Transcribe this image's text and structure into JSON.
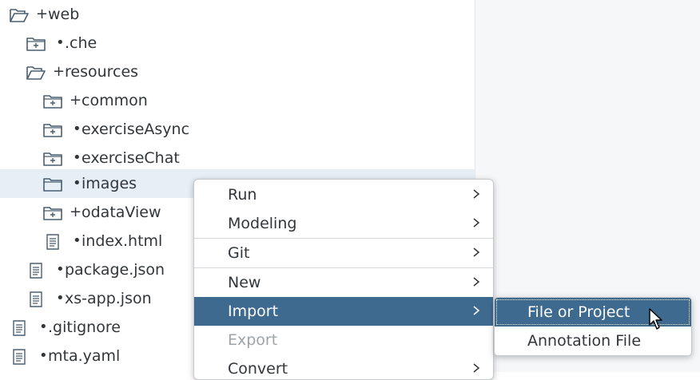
{
  "tree": {
    "items": [
      {
        "prefix": "+",
        "label": "web"
      },
      {
        "prefix": "•",
        "label": ".che"
      },
      {
        "prefix": "+",
        "label": "resources"
      },
      {
        "prefix": "+",
        "label": "common"
      },
      {
        "prefix": "•",
        "label": "exerciseAsync"
      },
      {
        "prefix": "•",
        "label": "exerciseChat"
      },
      {
        "prefix": "•",
        "label": "images"
      },
      {
        "prefix": "+",
        "label": "odataView"
      },
      {
        "prefix": "•",
        "label": "index.html"
      },
      {
        "prefix": "•",
        "label": "package.json"
      },
      {
        "prefix": "•",
        "label": "xs-app.json"
      },
      {
        "prefix": "•",
        "label": ".gitignore"
      },
      {
        "prefix": "•",
        "label": "mta.yaml"
      }
    ]
  },
  "context_menu": {
    "items": [
      {
        "label": "Run"
      },
      {
        "label": "Modeling"
      },
      {
        "label": "Git"
      },
      {
        "label": "New"
      },
      {
        "label": "Import"
      },
      {
        "label": "Export"
      },
      {
        "label": "Convert"
      }
    ]
  },
  "submenu": {
    "items": [
      {
        "label": "File or Project"
      },
      {
        "label": "Annotation File"
      }
    ]
  },
  "colors": {
    "highlight": "#3f6a90",
    "selected_row": "#e6eef6",
    "icon": "#4a5e72"
  }
}
